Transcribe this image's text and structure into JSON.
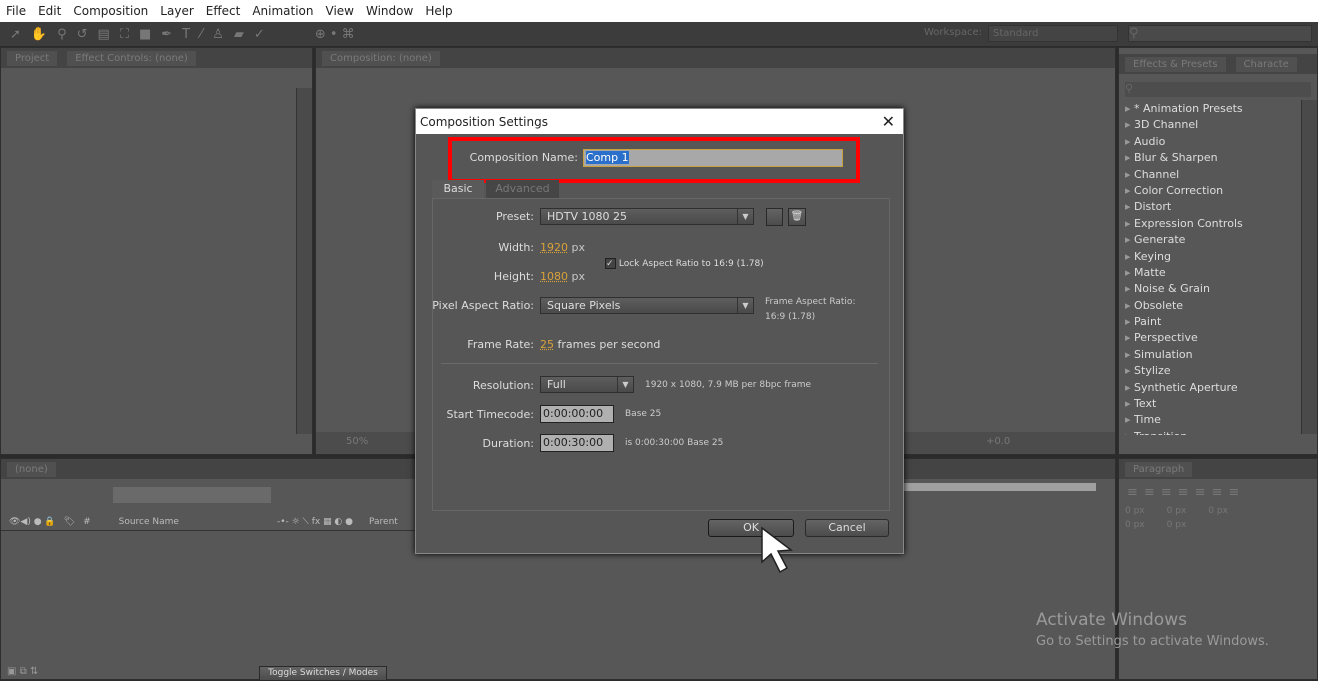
{
  "menu": [
    "File",
    "Edit",
    "Composition",
    "Layer",
    "Effect",
    "Animation",
    "View",
    "Window",
    "Help"
  ],
  "workspace": {
    "label": "Workspace:",
    "value": "Standard"
  },
  "left_panel": {
    "tabs": [
      "Project",
      "Effect Controls: (none)"
    ]
  },
  "comp_panel": {
    "tab": "Composition: (none)",
    "zoom": "50%",
    "exposure": "+0.0"
  },
  "effects_panel": {
    "tabs": [
      "Effects & Presets",
      "Characte"
    ],
    "items": [
      "* Animation Presets",
      "3D Channel",
      "Audio",
      "Blur & Sharpen",
      "Channel",
      "Color Correction",
      "Distort",
      "Expression Controls",
      "Generate",
      "Keying",
      "Matte",
      "Noise & Grain",
      "Obsolete",
      "Paint",
      "Perspective",
      "Simulation",
      "Stylize",
      "Synthetic Aperture",
      "Text",
      "Time",
      "Transition"
    ]
  },
  "timeline": {
    "tab": "(none)",
    "columns": {
      "number": "#",
      "source": "Source Name",
      "parent": "Parent"
    },
    "toggle_label": "Toggle Switches / Modes"
  },
  "paragraph": {
    "tab": "Paragraph",
    "values": [
      "0 px",
      "0 px",
      "0 px",
      "0 px",
      "0 px"
    ]
  },
  "dialog": {
    "title": "Composition Settings",
    "name_label": "Composition Name:",
    "name_value": "Comp 1",
    "tabs": [
      "Basic",
      "Advanced"
    ],
    "preset_label": "Preset:",
    "preset_value": "HDTV 1080 25",
    "width_label": "Width:",
    "width_value": "1920",
    "px": "px",
    "height_label": "Height:",
    "height_value": "1080",
    "lock_label": "Lock Aspect Ratio to 16:9 (1.78)",
    "lock_checked": true,
    "par_label": "Pixel Aspect Ratio:",
    "par_value": "Square Pixels",
    "far_label": "Frame Aspect Ratio:",
    "far_value": "16:9 (1.78)",
    "fr_label": "Frame Rate:",
    "fr_value": "25",
    "fr_unit": "frames per second",
    "res_label": "Resolution:",
    "res_value": "Full",
    "res_info": "1920 x 1080, 7.9 MB per 8bpc frame",
    "start_label": "Start Timecode:",
    "start_value": "0:00:00:00",
    "start_info": "Base 25",
    "dur_label": "Duration:",
    "dur_value": "0:00:30:00",
    "dur_info": "is 0:00:30:00  Base 25",
    "ok": "OK",
    "cancel": "Cancel"
  },
  "watermark": {
    "title": "Activate Windows",
    "subtitle": "Go to Settings to activate Windows."
  },
  "colors": {
    "highlight": "#ff0000",
    "accent_value": "#d8a13a"
  }
}
